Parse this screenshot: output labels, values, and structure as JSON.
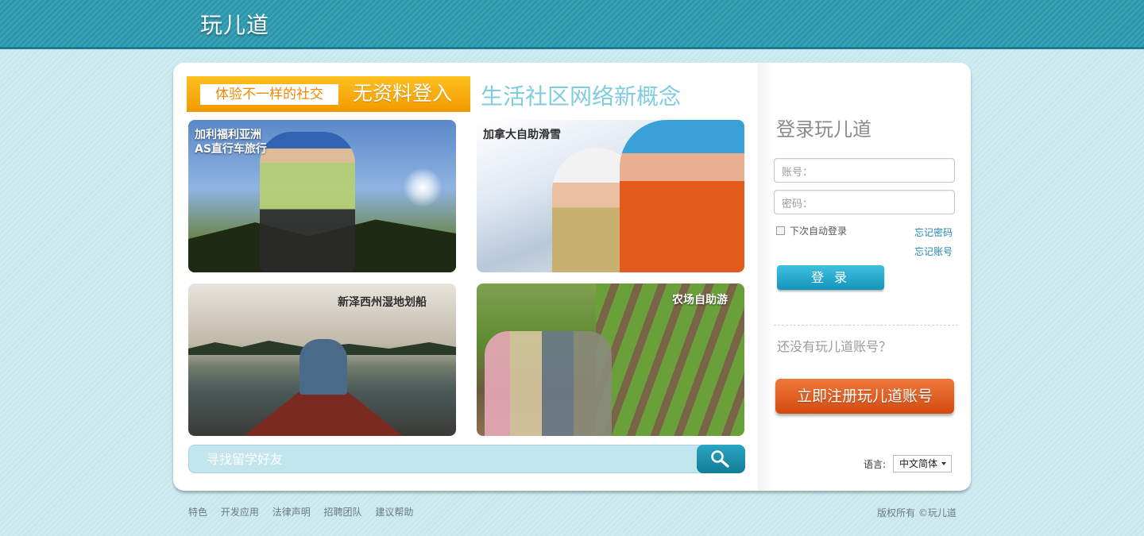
{
  "header": {
    "logo": "玩儿道"
  },
  "promo": {
    "left_label": "体验不一样的社交",
    "right_label": "无资料登入"
  },
  "slogan": "生活社区网络新概念",
  "tiles": [
    {
      "caption": "加利福利亚洲\nAS直行车旅行"
    },
    {
      "caption": "加拿大自助滑雪"
    },
    {
      "caption": "新泽西州湿地划船"
    },
    {
      "caption": "农场自助游"
    }
  ],
  "search": {
    "placeholder": "寻找留学好友",
    "icon": "search-icon"
  },
  "login": {
    "title": "登录玩儿道",
    "account_label": "账号：",
    "password_label": "密码：",
    "remember_label": "下次自动登录",
    "forgot_password": "忘记密码",
    "forgot_account": "忘记账号",
    "submit": "登 录"
  },
  "register": {
    "prompt": "还没有玩儿道账号？",
    "button": "立即注册玩儿道账号"
  },
  "language": {
    "label": "语言:",
    "selected": "中文简体"
  },
  "footer": {
    "links": [
      "特色",
      "开发应用",
      "法律声明",
      "招聘团队",
      "建议帮助"
    ],
    "copyright": "版权所有 ©玩儿道"
  },
  "colors": {
    "header": "#2a97ad",
    "accent": "#1694ba",
    "register": "#e05a1a",
    "promo": "#f7a800"
  }
}
